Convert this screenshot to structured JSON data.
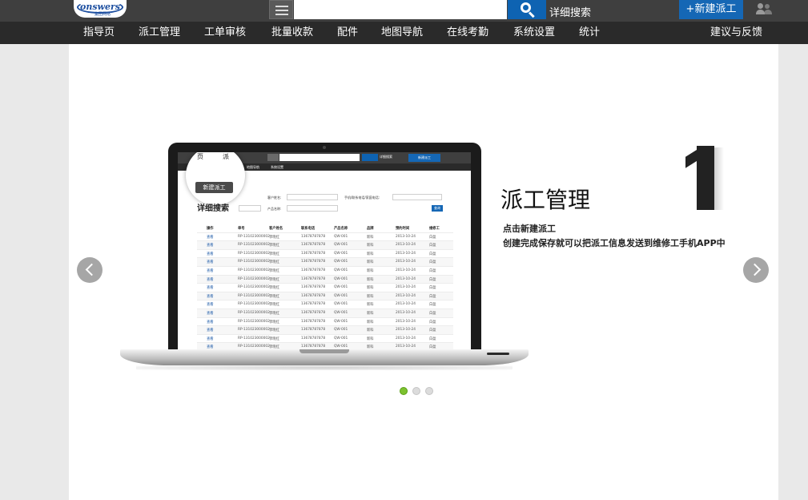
{
  "header": {
    "logo_text": "onswers",
    "logo_sub": "集团网络",
    "search_placeholder": "",
    "advanced_search_label": "详细搜索",
    "new_dispatch_label": "+新建派工"
  },
  "nav": {
    "items": [
      {
        "label": "指导页"
      },
      {
        "label": "派工管理"
      },
      {
        "label": "工单审核"
      },
      {
        "label": "批量收款"
      },
      {
        "label": "配件"
      },
      {
        "label": "地图导航"
      },
      {
        "label": "在线考勤"
      },
      {
        "label": "系统设置"
      },
      {
        "label": "统计"
      }
    ],
    "feedback_label": "建议与反馈"
  },
  "slide": {
    "number": "1",
    "title": "派工管理",
    "line1": "点击新建派工",
    "line2": "创建完成保存就可以把派工信息发送到维修工手机APP中",
    "dots": [
      {
        "active": true
      },
      {
        "active": false
      },
      {
        "active": false
      }
    ]
  },
  "mini_app": {
    "advanced_search": "详细搜索",
    "new_button": "新建派工",
    "nav_items": [
      "页",
      "派",
      "地图导航",
      "系统设置"
    ],
    "circle_new_button": "新建派工",
    "circle_advanced_search": "详细搜索",
    "form_labels": {
      "customer_name": "客户姓名:",
      "phone": "手机/联系电话/家庭电话:",
      "product_name": "产品名称:"
    },
    "query_button": "查询",
    "table": {
      "headers": [
        "操作",
        "单号",
        "客户姓名",
        "联系电话",
        "产品名称",
        "品牌",
        "预约时间",
        "维修工"
      ],
      "rows": [
        [
          "查看",
          "RP-131023000002",
          "李晓红",
          "13678787878",
          "QW-001",
          "新科",
          "2013-10-24",
          "白盈"
        ],
        [
          "查看",
          "RP-131023000002",
          "李晓红",
          "13678787878",
          "QW-001",
          "新科",
          "2013-10-24",
          "白盈"
        ],
        [
          "查看",
          "RP-131023000002",
          "李晓红",
          "13678787878",
          "QW-001",
          "新科",
          "2013-10-24",
          "白盈"
        ],
        [
          "查看",
          "RP-131023000002",
          "李晓红",
          "13678787878",
          "QW-001",
          "新科",
          "2013-10-24",
          "白盈"
        ],
        [
          "查看",
          "RP-131023000002",
          "李晓红",
          "13678787878",
          "QW-001",
          "新科",
          "2013-10-24",
          "白盈"
        ],
        [
          "查看",
          "RP-131023000002",
          "李晓红",
          "13678787878",
          "QW-001",
          "新科",
          "2013-10-24",
          "白盈"
        ],
        [
          "查看",
          "RP-131023000002",
          "李晓红",
          "13678787878",
          "QW-001",
          "新科",
          "2013-10-24",
          "白盈"
        ],
        [
          "查看",
          "RP-131023000002",
          "李晓红",
          "13678787878",
          "QW-001",
          "新科",
          "2013-10-24",
          "白盈"
        ],
        [
          "查看",
          "RP-131023000002",
          "李晓红",
          "13678787878",
          "QW-001",
          "新科",
          "2013-10-24",
          "白盈"
        ],
        [
          "查看",
          "RP-131023000002",
          "李晓红",
          "13678787878",
          "QW-001",
          "新科",
          "2013-10-24",
          "白盈"
        ],
        [
          "查看",
          "RP-131023000002",
          "李晓红",
          "13678787878",
          "QW-001",
          "新科",
          "2013-10-24",
          "白盈"
        ],
        [
          "查看",
          "RP-131023000002",
          "李晓红",
          "13678787878",
          "QW-001",
          "新科",
          "2013-10-24",
          "白盈"
        ],
        [
          "查看",
          "RP-131023000002",
          "李晓红",
          "13678787878",
          "QW-001",
          "新科",
          "2013-10-24",
          "白盈"
        ],
        [
          "查看",
          "RP-131023000002",
          "李晓红",
          "13678787878",
          "QW-001",
          "新科",
          "2013-10-24",
          "白盈"
        ]
      ]
    }
  },
  "colors": {
    "topbar": "#3f3f3f",
    "navbar": "#2a2a2a",
    "accent_blue": "#1567b5",
    "dot_active": "#7cc12f"
  },
  "icons": {
    "menu": "hamburger-icon",
    "search": "search-icon",
    "user": "users-icon",
    "prev": "chevron-left-icon",
    "next": "chevron-right-icon"
  }
}
